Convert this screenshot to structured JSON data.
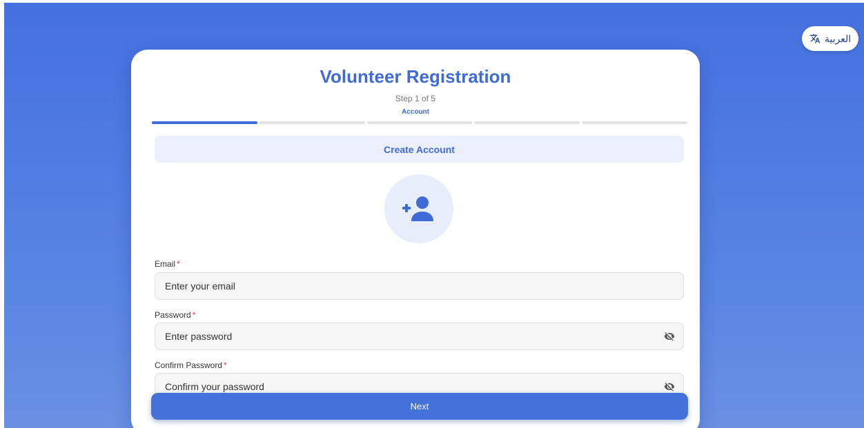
{
  "language_toggle": {
    "label": "العربية",
    "icon": "translate-icon"
  },
  "header": {
    "title": "Volunteer Registration",
    "step_text": "Step 1 of 5",
    "step_name": "Account",
    "progress": {
      "current_step": 1,
      "total_steps": 5
    }
  },
  "section": {
    "title": "Create Account",
    "icon": "person-add-icon"
  },
  "form": {
    "email": {
      "label": "Email",
      "required_mark": "*",
      "placeholder": "Enter your email",
      "value": ""
    },
    "password": {
      "label": "Password",
      "required_mark": "*",
      "placeholder": "Enter password",
      "value": "",
      "toggle_icon": "eye-off-icon"
    },
    "confirm_password": {
      "label": "Confirm Password",
      "required_mark": "*",
      "placeholder": "Confirm your password",
      "value": "",
      "toggle_icon": "eye-off-icon"
    }
  },
  "actions": {
    "next_label": "Next"
  },
  "colors": {
    "accent": "#3f6bd7",
    "background_gradient_top": "#4570e0",
    "background_gradient_bottom": "#6a90e2",
    "required": "#e53935"
  }
}
